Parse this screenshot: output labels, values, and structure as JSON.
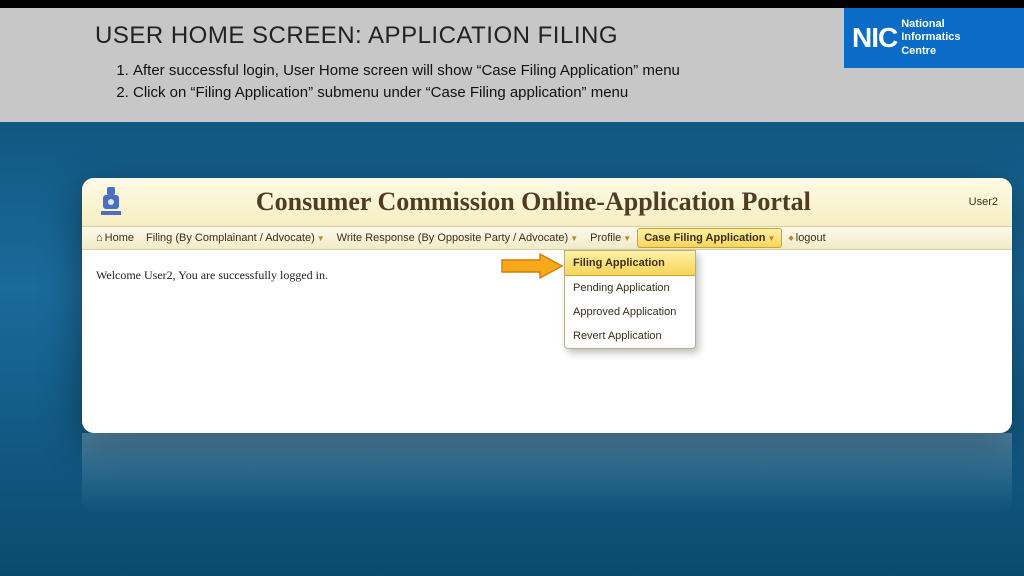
{
  "slide": {
    "title": "USER HOME SCREEN: APPLICATION FILING",
    "step1": "After successful login, User Home screen will show  “Case Filing Application” menu",
    "step2": "Click on “Filing Application” submenu under “Case  Filing application” menu"
  },
  "nic": {
    "abbrev": "NIC",
    "line1": "National",
    "line2": "Informatics",
    "line3": "Centre"
  },
  "portal": {
    "title": "Consumer Commission Online-Application Portal",
    "user": "User2",
    "welcome": "Welcome User2, You are successfully logged in."
  },
  "menu": {
    "home": "Home",
    "filing_complainant": "Filing (By Complainant / Advocate)",
    "write_response": "Write Response (By Opposite Party / Advocate)",
    "profile": "Profile",
    "case_filing": "Case Filing Application",
    "logout": "logout"
  },
  "dropdown": {
    "filing_app": "Filing Application",
    "pending": "Pending Application",
    "approved": "Approved Application",
    "revert": "Revert Application"
  }
}
